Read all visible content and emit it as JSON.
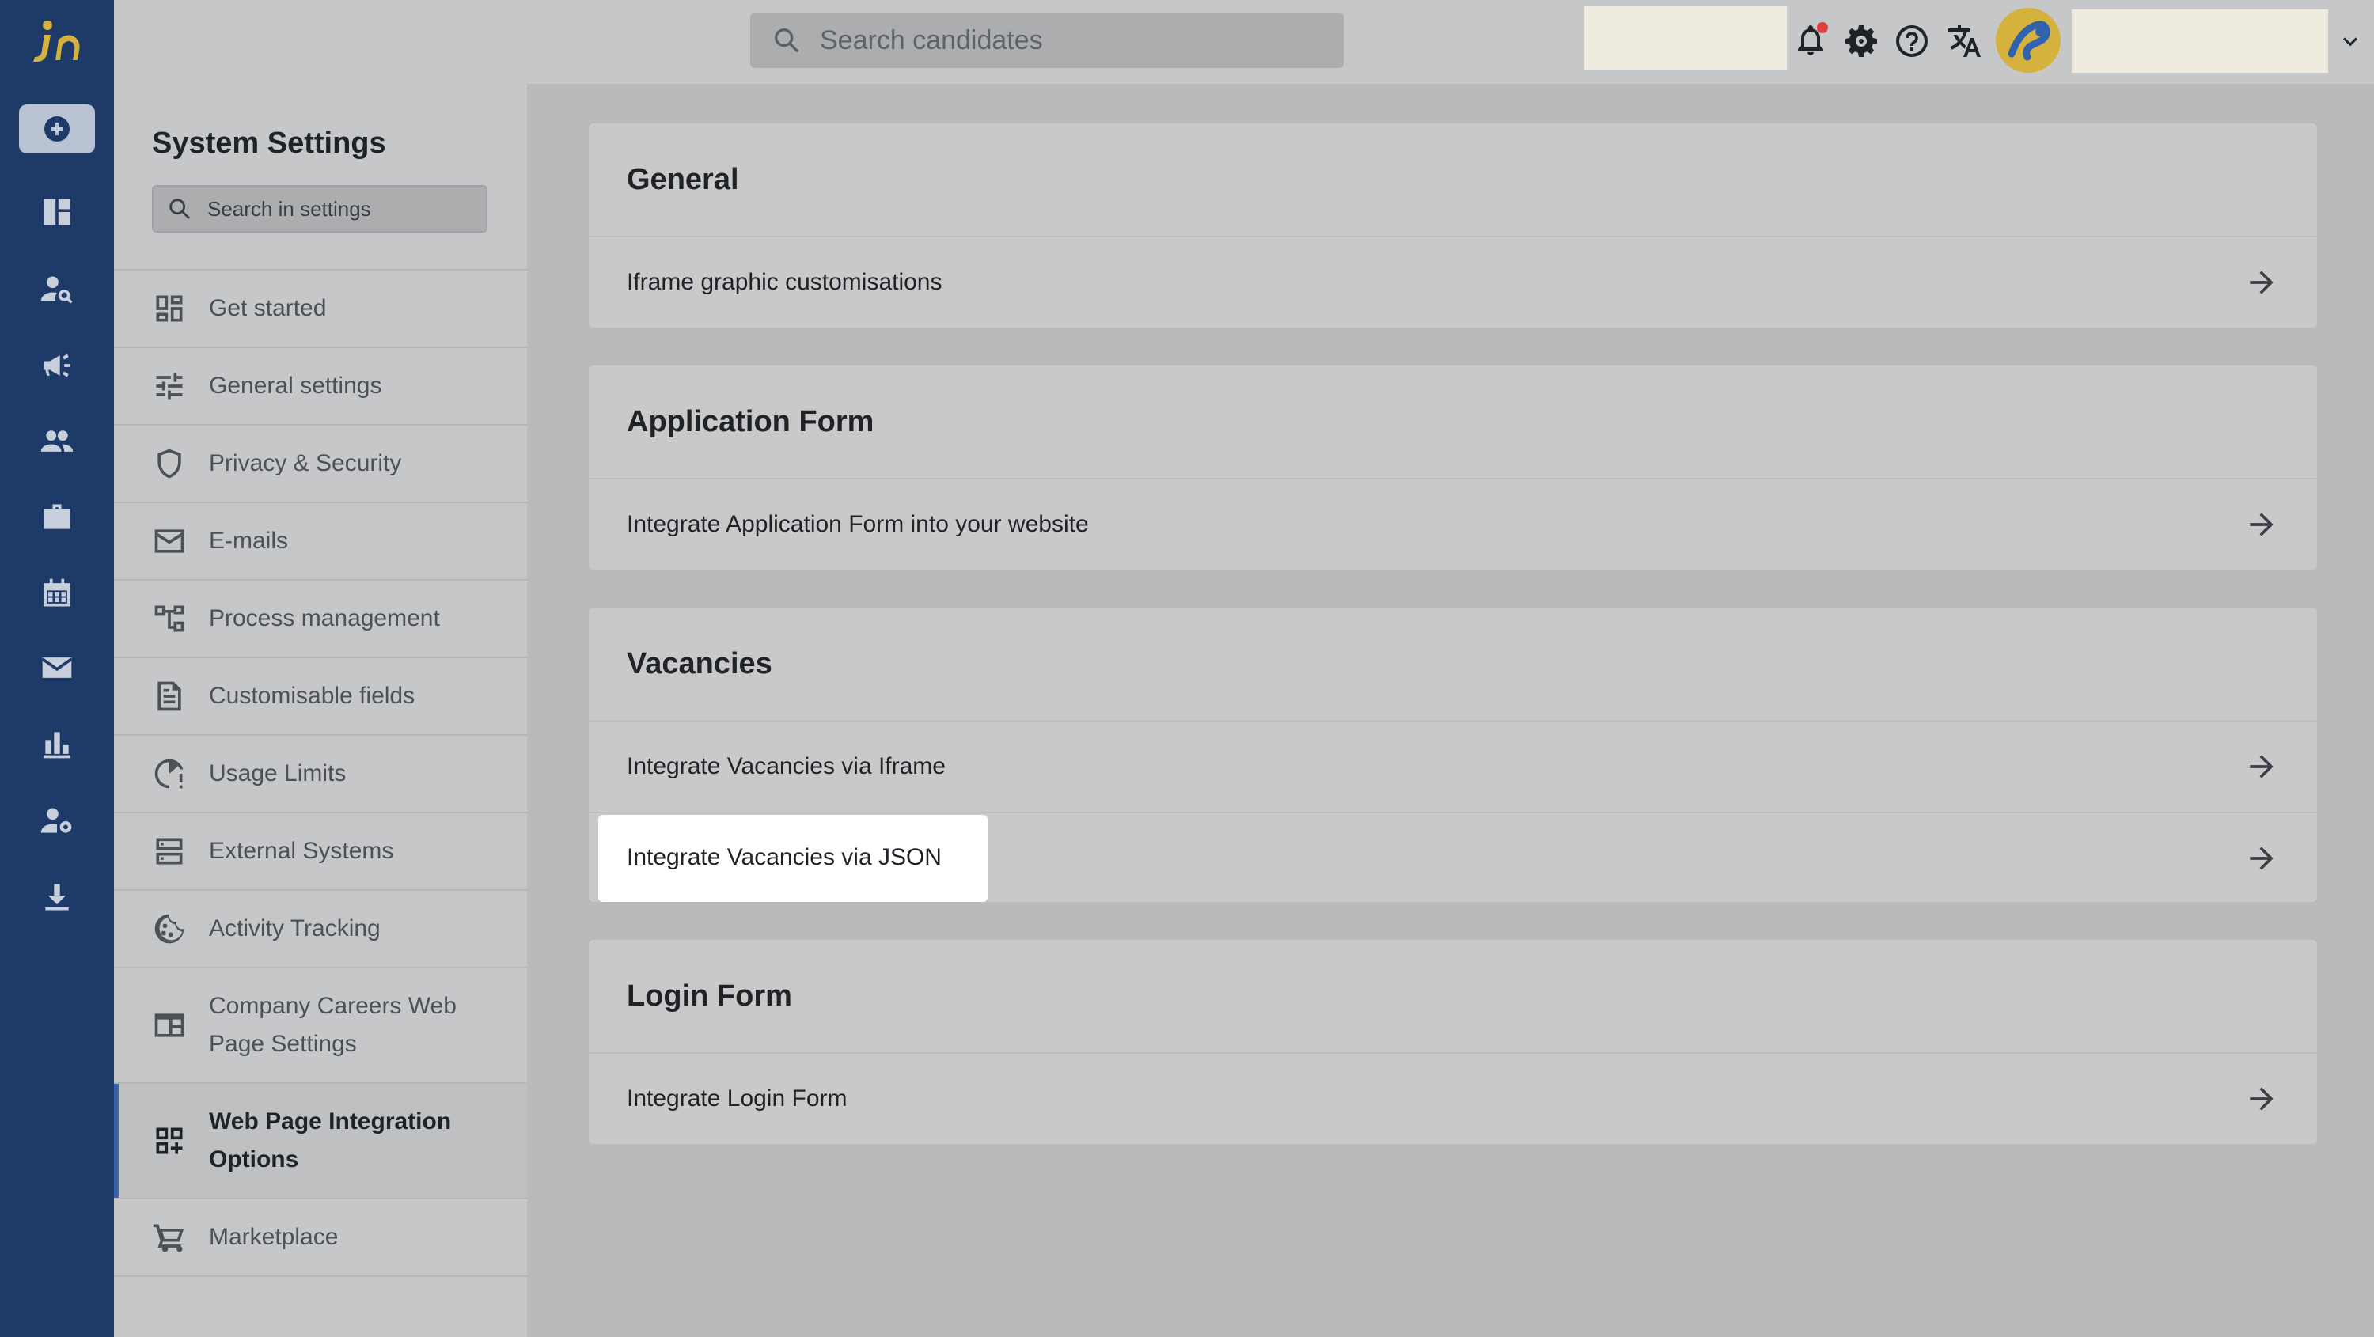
{
  "topbar": {
    "search_placeholder": "Search candidates"
  },
  "rail": {
    "logo_label": "in"
  },
  "sidebar": {
    "title": "System Settings",
    "search_placeholder": "Search in settings",
    "items": [
      {
        "label": "Get started",
        "icon": "dashboard-grid-icon"
      },
      {
        "label": "General settings",
        "icon": "sliders-icon"
      },
      {
        "label": "Privacy & Security",
        "icon": "shield-icon"
      },
      {
        "label": "E-mails",
        "icon": "mail-icon"
      },
      {
        "label": "Process management",
        "icon": "flow-icon"
      },
      {
        "label": "Customisable fields",
        "icon": "document-icon"
      },
      {
        "label": "Usage Limits",
        "icon": "gauge-icon"
      },
      {
        "label": "External Systems",
        "icon": "server-icon"
      },
      {
        "label": "Activity Tracking",
        "icon": "cookie-icon"
      },
      {
        "label": "Company Careers Web Page Settings",
        "icon": "web-page-icon"
      },
      {
        "label": "Web Page Integration Options",
        "icon": "widgets-icon",
        "active": true
      },
      {
        "label": "Marketplace",
        "icon": "cart-icon"
      }
    ]
  },
  "sections": [
    {
      "title": "General",
      "rows": [
        "Iframe graphic customisations"
      ]
    },
    {
      "title": "Application Form",
      "rows": [
        "Integrate Application Form into your website"
      ]
    },
    {
      "title": "Vacancies",
      "rows": [
        "Integrate Vacancies via Iframe",
        "Integrate Vacancies via JSON"
      ]
    },
    {
      "title": "Login Form",
      "rows": [
        "Integrate Login Form"
      ]
    }
  ],
  "colors": {
    "rail": "#1d3a68",
    "accent": "#3a62a8",
    "brand_yellow": "#d4b23d"
  }
}
